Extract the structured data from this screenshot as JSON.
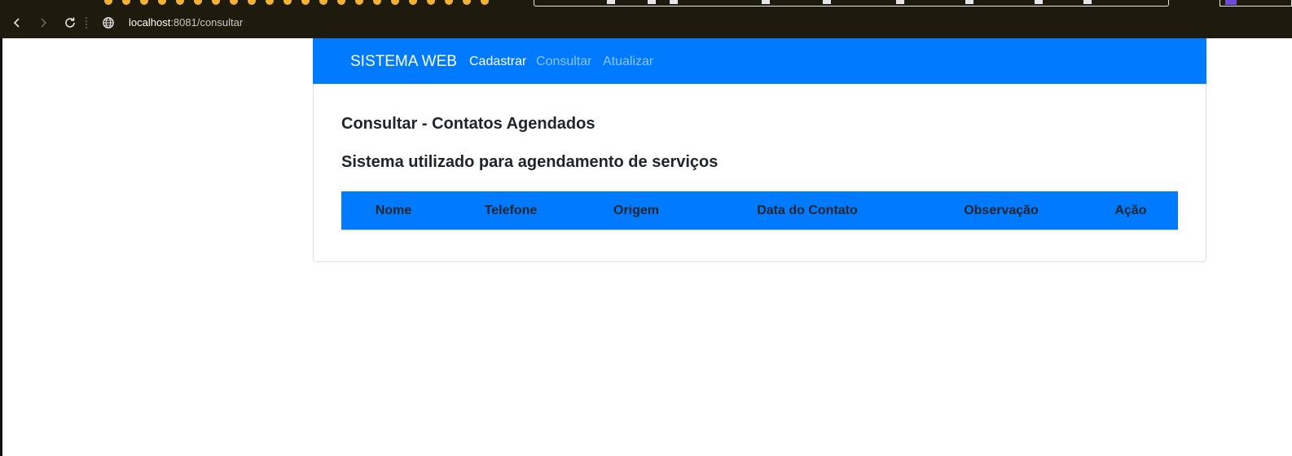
{
  "browser": {
    "url_host": "localhost",
    "url_rest": ":8081/consultar"
  },
  "navbar": {
    "brand": "SISTEMA WEB",
    "links": [
      {
        "label": "Cadastrar",
        "state": "active"
      },
      {
        "label": "Consultar",
        "state": "muted"
      },
      {
        "label": "Atualizar",
        "state": "muted"
      }
    ],
    "color": "#007bff"
  },
  "main": {
    "title": "Consultar - Contatos Agendados",
    "subtitle": "Sistema utilizado para agendamento de serviços",
    "table": {
      "columns": [
        "Nome",
        "Telefone",
        "Origem",
        "Data do Contato",
        "Observação",
        "Ação"
      ],
      "rows": []
    }
  },
  "icons": {
    "back": "chevron-left-icon",
    "forward": "chevron-right-icon",
    "reload": "reload-icon",
    "site": "globe-icon"
  }
}
